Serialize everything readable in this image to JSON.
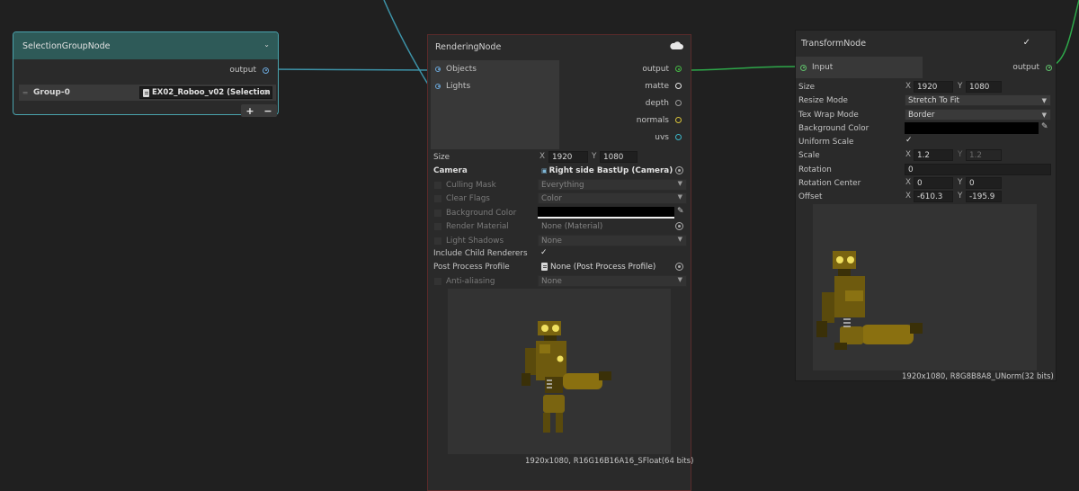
{
  "selection_node": {
    "title": "SelectionGroupNode",
    "output_label": "output",
    "group_label": "Group-0",
    "group_object": "EX02_Roboo_v02 (Selection",
    "add_label": "+",
    "remove_label": "−"
  },
  "rendering_node": {
    "title": "RenderingNode",
    "inputs": [
      "Objects",
      "Lights"
    ],
    "outputs": [
      {
        "label": "output",
        "color": "#46b946"
      },
      {
        "label": "matte",
        "color": "#e8e8e8"
      },
      {
        "label": "depth",
        "color": "#9a9a9a"
      },
      {
        "label": "normals",
        "color": "#d8c23a"
      },
      {
        "label": "uvs",
        "color": "#3cb6c8"
      }
    ],
    "size_label": "Size",
    "size_x_axis": "X",
    "size_x": "1920",
    "size_y_axis": "Y",
    "size_y": "1080",
    "camera_label": "Camera",
    "camera_value": "Right side BastUp (Camera)",
    "culling_mask_label": "Culling Mask",
    "culling_mask_value": "Everything",
    "clear_flags_label": "Clear Flags",
    "clear_flags_value": "Color",
    "background_color_label": "Background Color",
    "render_material_label": "Render Material",
    "render_material_value": "None (Material)",
    "light_shadows_label": "Light Shadows",
    "light_shadows_value": "None",
    "include_child_label": "Include Child Renderers",
    "post_process_label": "Post Process Profile",
    "post_process_value": "None (Post Process Profile)",
    "anti_aliasing_label": "Anti-aliasing",
    "anti_aliasing_value": "None",
    "resolution_info": "1920x1080, R16G16B16A16_SFloat(64 bits)"
  },
  "transform_node": {
    "title": "TransformNode",
    "input_label": "Input",
    "output_label": "output",
    "size_label": "Size",
    "size_x_axis": "X",
    "size_x": "1920",
    "size_y_axis": "Y",
    "size_y": "1080",
    "resize_mode_label": "Resize Mode",
    "resize_mode_value": "Stretch To Fit",
    "tex_wrap_label": "Tex Wrap Mode",
    "tex_wrap_value": "Border",
    "background_color_label": "Background Color",
    "uniform_scale_label": "Uniform Scale",
    "scale_label": "Scale",
    "scale_x_axis": "X",
    "scale_x": "1.2",
    "scale_y_axis": "Y",
    "scale_y": "1.2",
    "rotation_label": "Rotation",
    "rotation_value": "0",
    "rotation_center_label": "Rotation Center",
    "rc_x_axis": "X",
    "rc_x": "0",
    "rc_y_axis": "Y",
    "rc_y": "0",
    "offset_label": "Offset",
    "offset_x_axis": "X",
    "offset_x": "-610.3",
    "offset_y_axis": "Y",
    "offset_y": "-195.9",
    "resolution_info": "1920x1080, R8G8B8A8_UNorm(32 bits)"
  },
  "colors": {
    "wire_blue": "#3d93a8",
    "wire_green": "#2ea84a",
    "selection_header": "#2e5a58",
    "selection_border": "#4aa3ad"
  }
}
